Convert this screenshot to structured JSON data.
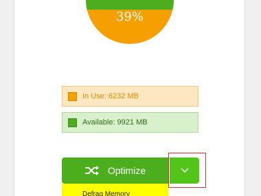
{
  "memory": {
    "percent_label": "39%",
    "used_fraction": 0.39,
    "colors": {
      "used": "#f5a000",
      "available": "#4cae1c"
    }
  },
  "legend": {
    "in_use_label": "In Use: 6232 MB",
    "available_label": "Available: 9921 MB"
  },
  "actions": {
    "optimize_label": "Optimize",
    "optimize_icon": "shuffle-icon",
    "dropdown_icon": "chevron-down-icon"
  },
  "menu": {
    "items": [
      {
        "label": "Defrag Memory"
      }
    ]
  }
}
